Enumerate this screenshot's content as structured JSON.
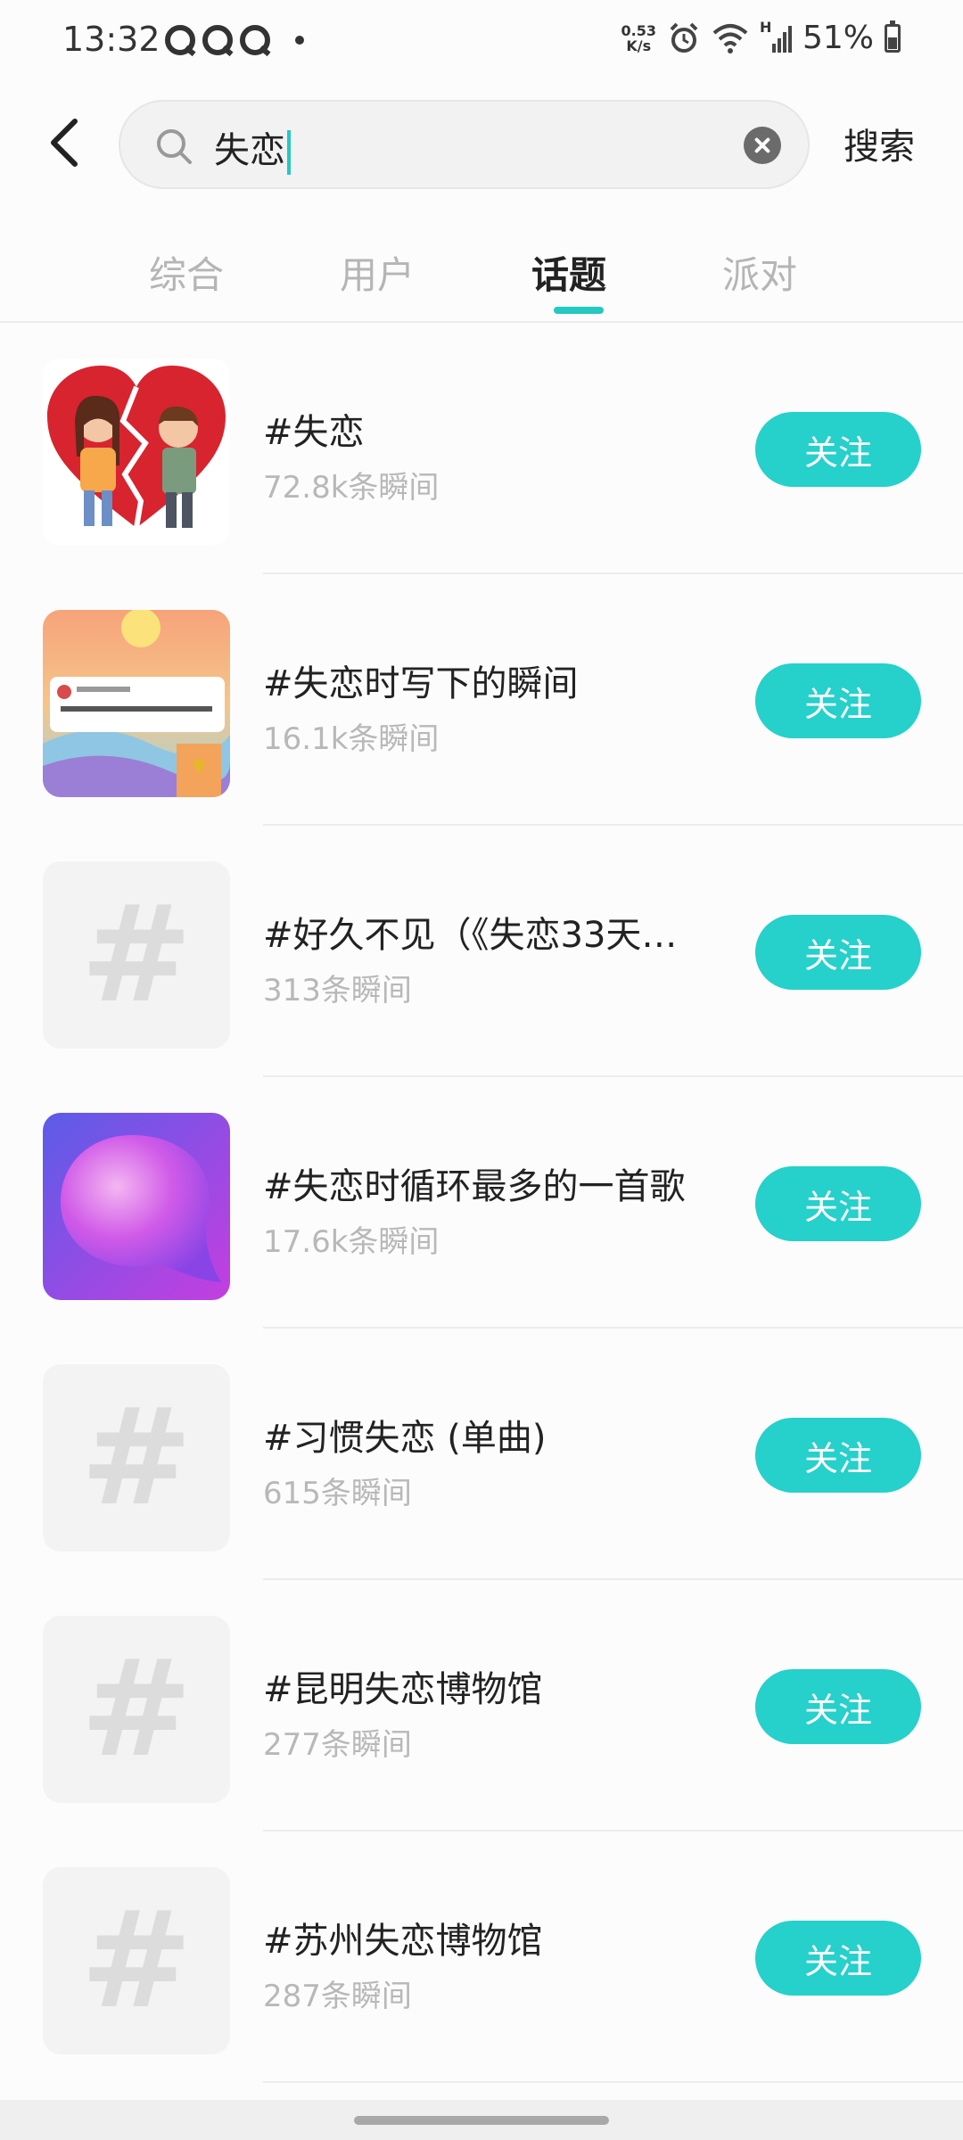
{
  "status_bar": {
    "time": "13:32",
    "net_speed_value": "0.53",
    "net_speed_unit": "K/s",
    "network_type": "H",
    "battery": "51%"
  },
  "search": {
    "query": "失恋",
    "clear_icon": "clear-icon",
    "submit_label": "搜索"
  },
  "tabs": [
    {
      "label": "综合",
      "active": false
    },
    {
      "label": "用户",
      "active": false
    },
    {
      "label": "话题",
      "active": true
    },
    {
      "label": "派对",
      "active": false
    }
  ],
  "accent_color": "#26d0cb",
  "topics": [
    {
      "title": "#失恋",
      "count": "72.8k条瞬间",
      "thumb": "broken-heart-couple",
      "follow_label": "关注"
    },
    {
      "title": "#失恋时写下的瞬间",
      "count": "16.1k条瞬间",
      "thumb": "sunset-card",
      "follow_label": "关注"
    },
    {
      "title": "#好久不见（《失恋33天》...",
      "count": "313条瞬间",
      "thumb": "hash-placeholder",
      "follow_label": "关注"
    },
    {
      "title": "#失恋时循环最多的一首歌",
      "count": "17.6k条瞬间",
      "thumb": "purple-bubble",
      "follow_label": "关注"
    },
    {
      "title": "#习惯失恋 (单曲)",
      "count": "615条瞬间",
      "thumb": "hash-placeholder",
      "follow_label": "关注"
    },
    {
      "title": "#昆明失恋博物馆",
      "count": "277条瞬间",
      "thumb": "hash-placeholder",
      "follow_label": "关注"
    },
    {
      "title": "#苏州失恋博物馆",
      "count": "287条瞬间",
      "thumb": "hash-placeholder",
      "follow_label": "关注"
    }
  ]
}
